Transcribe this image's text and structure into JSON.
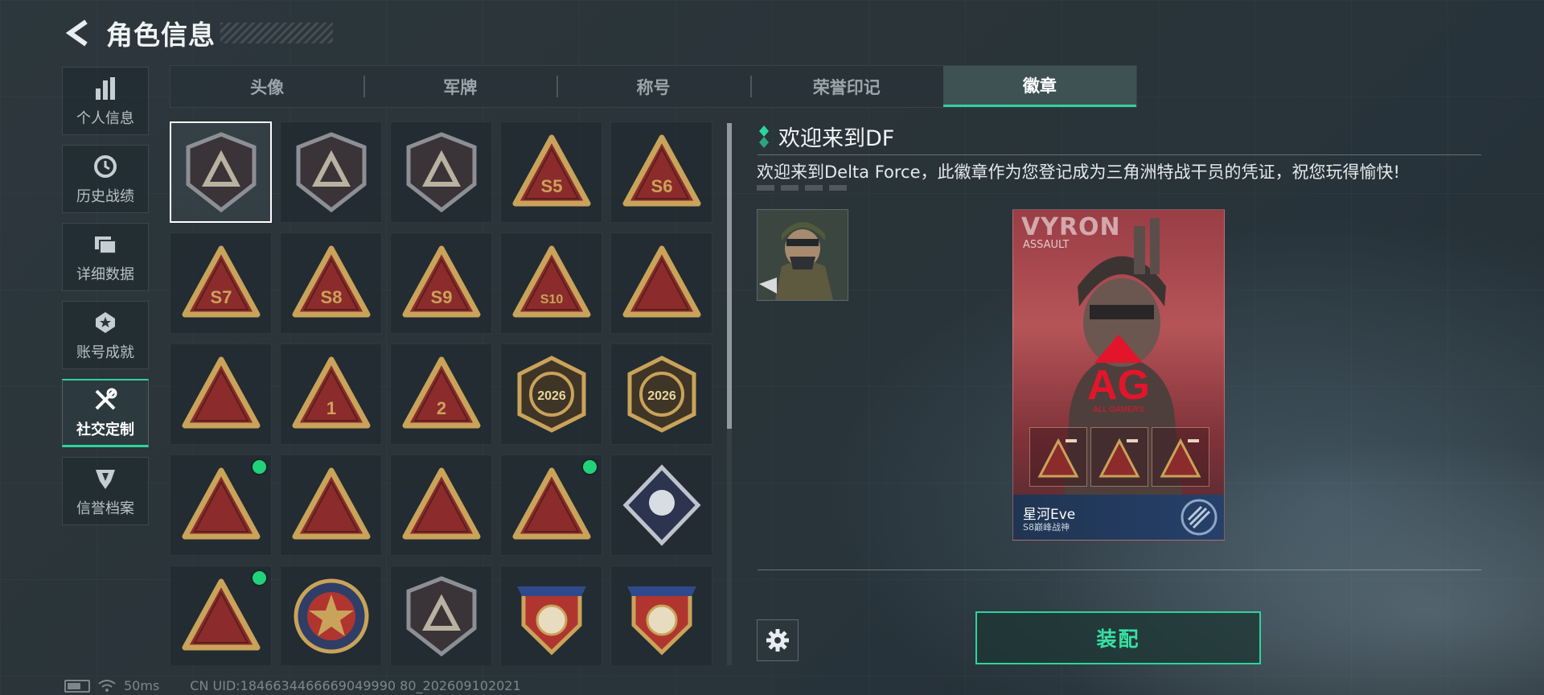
{
  "header": {
    "title": "角色信息"
  },
  "sidenav": [
    {
      "label": "个人信息",
      "icon": "bar-chart-icon",
      "active": false
    },
    {
      "label": "历史战绩",
      "icon": "clock-icon",
      "active": false
    },
    {
      "label": "详细数据",
      "icon": "folder-icon",
      "active": false
    },
    {
      "label": "账号成就",
      "icon": "achievement-icon",
      "active": false
    },
    {
      "label": "社交定制",
      "icon": "wrench-icon",
      "active": true
    },
    {
      "label": "信誉档案",
      "icon": "shield-icon",
      "active": false
    }
  ],
  "tabs": [
    {
      "label": "头像",
      "active": false
    },
    {
      "label": "军牌",
      "active": false
    },
    {
      "label": "称号",
      "active": false
    },
    {
      "label": "荣誉印记",
      "active": false
    },
    {
      "label": "徽章",
      "active": true
    }
  ],
  "badges": [
    {
      "name": "delta-force-logo",
      "text": "",
      "shape": "shield",
      "selected": true,
      "new": false
    },
    {
      "name": "helicopter",
      "text": "",
      "shape": "shield",
      "selected": false,
      "new": false
    },
    {
      "name": "geometric-logo",
      "text": "",
      "shape": "shield",
      "selected": false,
      "new": false
    },
    {
      "name": "season-5",
      "text": "S5",
      "shape": "triangle",
      "selected": false,
      "new": false
    },
    {
      "name": "season-6",
      "text": "S6",
      "shape": "triangle",
      "selected": false,
      "new": false
    },
    {
      "name": "season-7",
      "text": "S7",
      "shape": "triangle",
      "selected": false,
      "new": false
    },
    {
      "name": "season-8",
      "text": "S8",
      "shape": "triangle",
      "selected": false,
      "new": false
    },
    {
      "name": "season-9",
      "text": "S9",
      "shape": "triangle",
      "selected": false,
      "new": false
    },
    {
      "name": "season-10",
      "text": "S10",
      "shape": "triangle",
      "selected": false,
      "new": false
    },
    {
      "name": "gas-mask",
      "text": "",
      "shape": "triangle",
      "selected": false,
      "new": false
    },
    {
      "name": "nest",
      "text": "",
      "shape": "triangle",
      "selected": false,
      "new": false
    },
    {
      "name": "rank-1",
      "text": "1",
      "shape": "triangle",
      "selected": false,
      "new": false
    },
    {
      "name": "rank-2",
      "text": "2",
      "shape": "triangle",
      "selected": false,
      "new": false
    },
    {
      "name": "delta-force-2026-wall",
      "text": "2026",
      "shape": "hex",
      "selected": false,
      "new": false
    },
    {
      "name": "delta-force-2026-globe",
      "text": "2026",
      "shape": "hex",
      "selected": false,
      "new": false
    },
    {
      "name": "soldier-kneel",
      "text": "",
      "shape": "triangle",
      "selected": false,
      "new": true
    },
    {
      "name": "hands-dice",
      "text": "",
      "shape": "triangle",
      "selected": false,
      "new": false
    },
    {
      "name": "squad",
      "text": "",
      "shape": "triangle",
      "selected": false,
      "new": false
    },
    {
      "name": "rocket",
      "text": "",
      "shape": "triangle",
      "selected": false,
      "new": true
    },
    {
      "name": "rose",
      "text": "",
      "shape": "diamond",
      "selected": false,
      "new": false
    },
    {
      "name": "astronaut",
      "text": "",
      "shape": "triangle",
      "selected": false,
      "new": true
    },
    {
      "name": "star-emblem",
      "text": "",
      "shape": "circle",
      "selected": false,
      "new": false
    },
    {
      "name": "winged-shield",
      "text": "",
      "shape": "shield",
      "selected": false,
      "new": false
    },
    {
      "name": "stars-crest",
      "text": "",
      "shape": "crest",
      "selected": false,
      "new": false
    },
    {
      "name": "stars-crest-dice",
      "text": "",
      "shape": "crest",
      "selected": false,
      "new": false
    }
  ],
  "detail": {
    "title": "欢迎来到DF",
    "description": "欢迎来到Delta Force，此徽章作为您登记成为三角洲特战干员的凭证，祝您玩得愉快!",
    "card": {
      "operator": "VYRON",
      "role": "ASSAULT",
      "player": "星河Eve",
      "rank": "S8巅峰战神",
      "logo_text": "AG",
      "logo_sub": "ALL GAMERS"
    },
    "equip_label": "装配"
  },
  "status": {
    "ping": "50ms",
    "uid": "CN UID:1846634466669049990 80_202609102021"
  },
  "colors": {
    "accent": "#2fd39b",
    "badge_gold": "#c9a35a",
    "badge_red": "#8c2b2b",
    "new_dot": "#20d27a"
  }
}
